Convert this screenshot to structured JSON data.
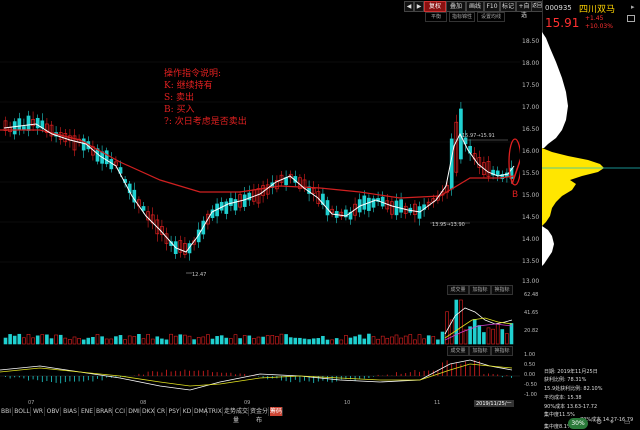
{
  "toolbar": {
    "buttons": [
      "复权",
      "叠加",
      "画线",
      "F10",
      "标记",
      "+自选",
      "返回"
    ],
    "selected": "复权",
    "nav_glyphs": [
      "◀",
      "▶"
    ]
  },
  "subbar": {
    "buttons": [
      "平衡",
      "指标锦性",
      "设置均线"
    ]
  },
  "stock": {
    "code": "000935",
    "name": "四川双马",
    "price": "15.91",
    "change": "+1.45",
    "change_pct": "+10.03%"
  },
  "y_axis_main": [
    "18.50",
    "18.00",
    "17.50",
    "17.00",
    "16.50",
    "16.00",
    "15.50",
    "15.00",
    "14.50",
    "14.00",
    "13.50",
    "13.00"
  ],
  "x_axis_months": [
    "07",
    "08",
    "09",
    "10",
    "11"
  ],
  "x_axis_date_tag": "2019/11/25/一",
  "annotation": {
    "title": "操作指令说明:",
    "lines": [
      "K: 继续持有",
      "S: 卖出",
      "B: 买入",
      "?: 次日考虑是否卖出"
    ]
  },
  "price_labels": {
    "low": "12.47",
    "box_top": "15.97→15.91",
    "box_bottom": "13.95→13.90",
    "signal": "B"
  },
  "volume_panel": {
    "tabs": [
      "成交量",
      "加指标",
      "换指标"
    ],
    "y_axis": [
      "62.48",
      "41.65",
      "20.82"
    ]
  },
  "macd_panel": {
    "tabs": [
      "成交量",
      "加指标",
      "换指标"
    ],
    "y_axis": [
      "1.00",
      "0.50",
      "0.00",
      "-0.50",
      "-1.00"
    ]
  },
  "bottom_tabs": [
    "BBI",
    "BOLL",
    "WR",
    "OBV",
    "BIAS",
    "ENE",
    "BRAR",
    "CCI",
    "DMI",
    "DKX",
    "CR",
    "PSY",
    "KD",
    "DMA",
    "TRIX",
    "走势成交量",
    "资金分布",
    "筹码"
  ],
  "bottom_selected": "筹码",
  "info_panel": {
    "date": "日期: 2019年11月25日",
    "rows": [
      "获利比例: 78.31%",
      "15.9处获利比例: 82.10%",
      "平均成本: 15.38",
      "90%成本 13.63-17.72",
      "集中度11.5%",
      "70%成本 14.27-16.79",
      "集中度8.1%"
    ]
  },
  "zoom": "30%",
  "colors": {
    "up": "#e02020",
    "down": "#20d0d0",
    "ma_long": "#d02020",
    "ma_short": "#ffffff",
    "profile_fill": "#ffe600",
    "profile_white": "#ffffff"
  }
}
